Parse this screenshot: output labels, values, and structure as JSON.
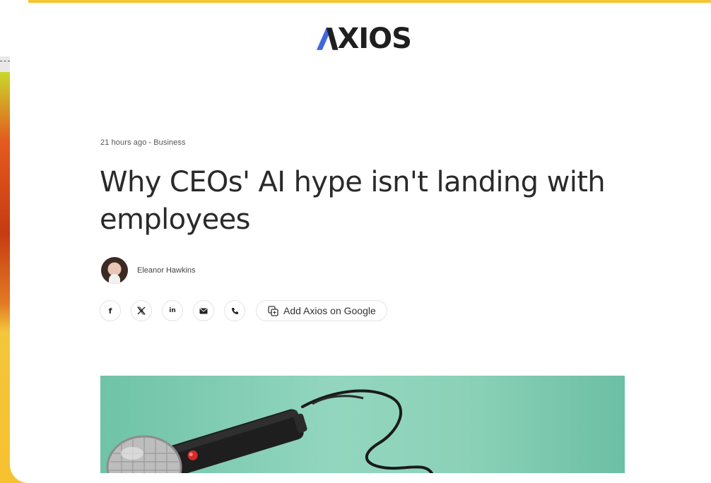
{
  "brand": {
    "logo_text": "XIOS",
    "logo_accent_color": "#3f67e0",
    "accent_color": "#f6c230"
  },
  "article": {
    "time": "21 hours ago",
    "separator": "-",
    "section": "Business",
    "headline": "Why CEOs' AI hype isn't landing with employees",
    "author": "Eleanor Hawkins"
  },
  "share": {
    "icons": [
      "facebook-icon",
      "x-icon",
      "linkedin-icon",
      "email-icon",
      "phone-icon"
    ],
    "facebook_glyph": "f",
    "linkedin_glyph": "in",
    "google_button_label": "Add Axios on Google"
  },
  "hero": {
    "description_icon": "microphone-illustration",
    "background_color": "#8fd3bb"
  }
}
